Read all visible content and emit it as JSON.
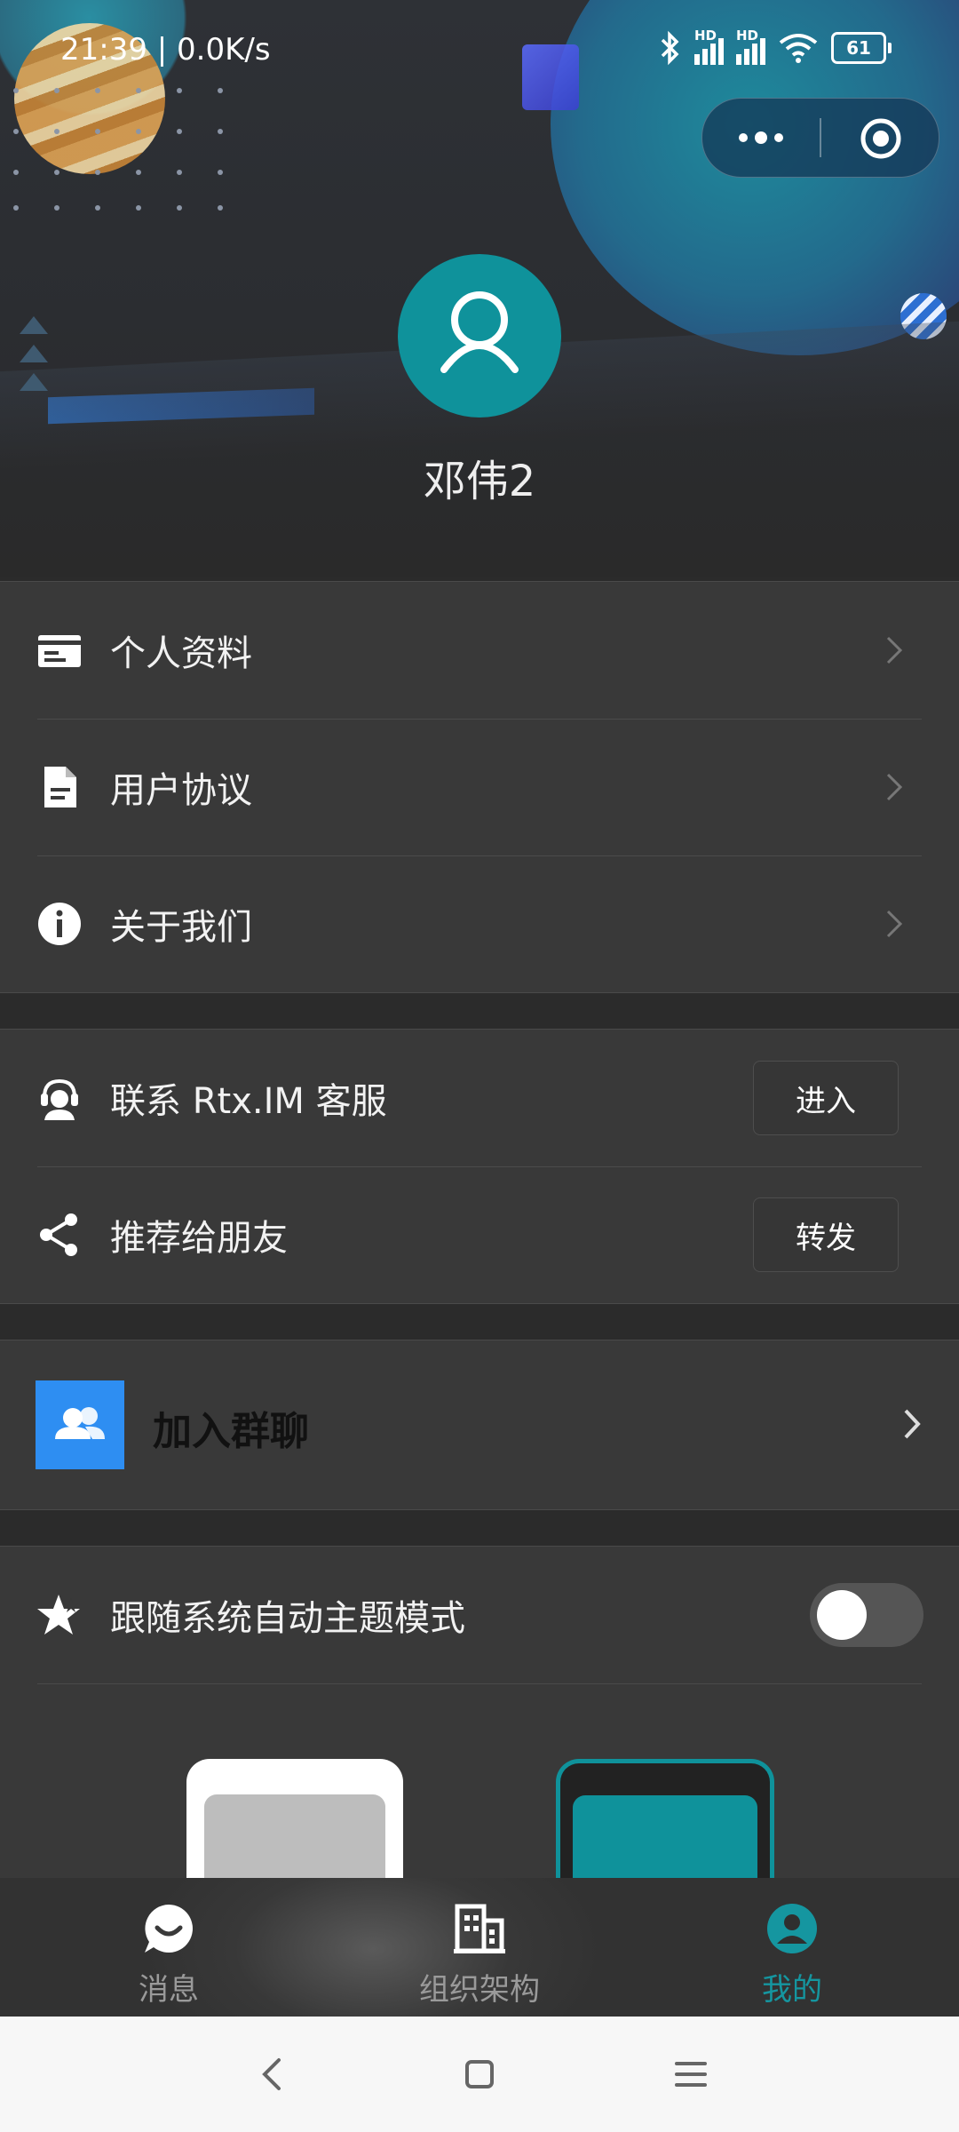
{
  "status_bar": {
    "time_speed": "21:39 | 0.0K/s",
    "signal_labels": [
      "HD",
      "HD"
    ],
    "battery": "61"
  },
  "profile": {
    "username": "邓伟2"
  },
  "menu_section_1": {
    "items": [
      {
        "label": "个人资料",
        "icon": "id-card-icon"
      },
      {
        "label": "用户协议",
        "icon": "document-icon"
      },
      {
        "label": "关于我们",
        "icon": "info-icon"
      }
    ]
  },
  "menu_section_2": {
    "items": [
      {
        "label": "联系 Rtx.IM 客服",
        "button": "进入",
        "icon": "customer-service-icon"
      },
      {
        "label": "推荐给朋友",
        "button": "转发",
        "icon": "share-icon"
      }
    ]
  },
  "group_chat": {
    "label": "加入群聊",
    "icon_color": "#2e8ef2"
  },
  "theme": {
    "follow_system_label": "跟随系统自动主题模式",
    "follow_system_on": false,
    "selected": "dark"
  },
  "tab_bar": {
    "tabs": [
      {
        "label": "消息",
        "icon": "chat-bubble-icon",
        "active": false
      },
      {
        "label": "组织架构",
        "icon": "building-icon",
        "active": false
      },
      {
        "label": "我的",
        "icon": "user-circle-icon",
        "active": true
      }
    ]
  },
  "colors": {
    "accent": "#0f929b",
    "active_tab": "#1596a0",
    "background": "#2b2b2b",
    "card": "#393939"
  }
}
